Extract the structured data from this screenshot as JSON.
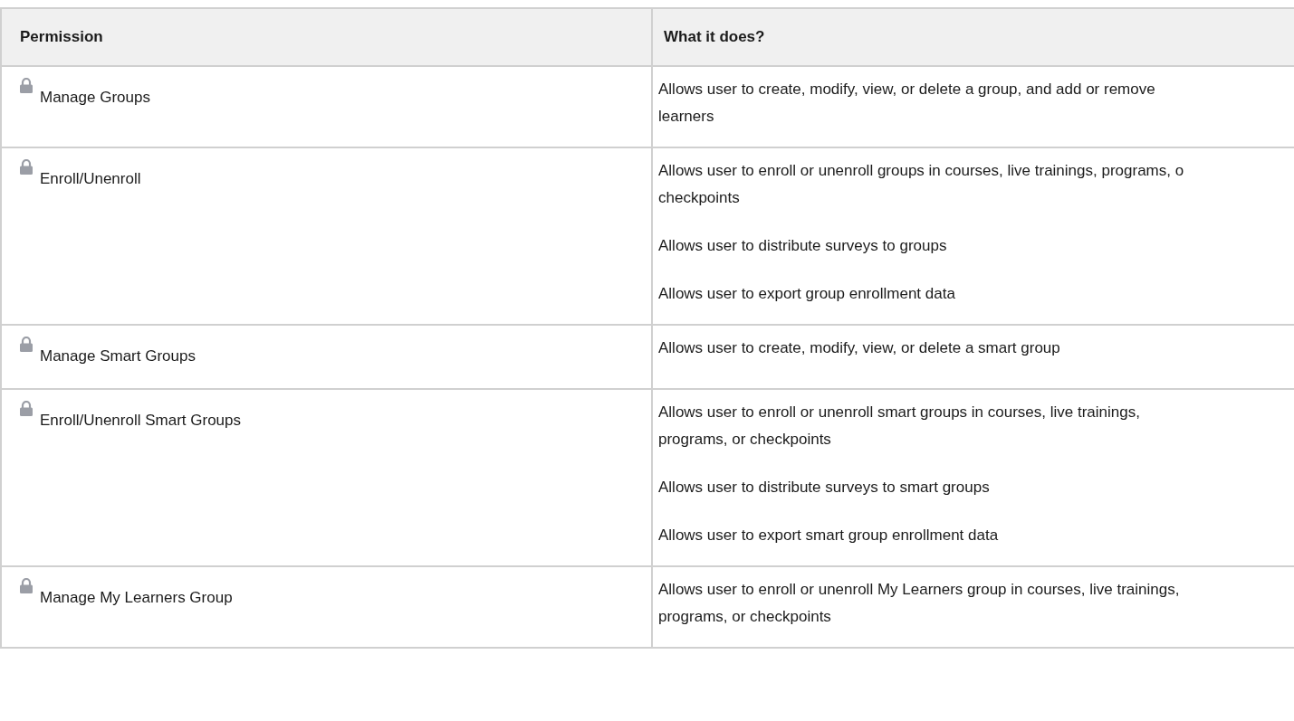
{
  "table": {
    "columns": [
      "Permission",
      "What it does?"
    ],
    "rows": [
      {
        "permission": "Manage Groups",
        "locked": true,
        "description": [
          [
            "Allows user to create, modify, view, or delete a group, and add or remove",
            "learners"
          ]
        ]
      },
      {
        "permission": "Enroll/Unenroll",
        "locked": true,
        "description": [
          [
            "Allows user to enroll or unenroll groups in courses, live trainings, programs, o",
            "checkpoints"
          ],
          [
            "Allows user to distribute surveys to groups"
          ],
          [
            "Allows user to export group enrollment data"
          ]
        ]
      },
      {
        "permission": "Manage Smart Groups",
        "locked": true,
        "description": [
          [
            "Allows user to create, modify, view, or delete a smart group"
          ]
        ]
      },
      {
        "permission": "Enroll/Unenroll Smart Groups",
        "locked": true,
        "description": [
          [
            "Allows user to enroll or unenroll smart groups in courses, live trainings,",
            "programs, or checkpoints"
          ],
          [
            "Allows user to distribute surveys to smart groups"
          ],
          [
            "Allows user to export smart group enrollment data"
          ]
        ]
      },
      {
        "permission": "Manage My Learners Group",
        "locked": true,
        "description": [
          [
            "Allows user to enroll or unenroll My Learners group in courses, live trainings,",
            "programs, or checkpoints"
          ]
        ]
      }
    ]
  }
}
